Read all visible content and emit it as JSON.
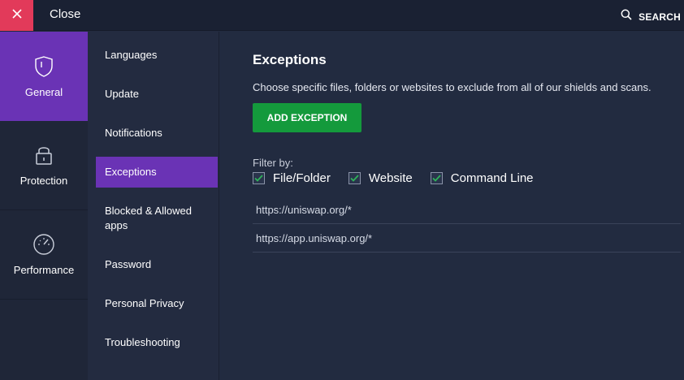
{
  "colors": {
    "accent": "#6a33b5",
    "close": "#e23a5a",
    "primary_button": "#149a3c",
    "bg_main": "#222b40"
  },
  "topbar": {
    "close_label": "Close",
    "search_label": "SEARCH"
  },
  "rail": [
    {
      "label": "General",
      "icon": "shield-icon",
      "active": true
    },
    {
      "label": "Protection",
      "icon": "lock-icon",
      "active": false
    },
    {
      "label": "Performance",
      "icon": "speedometer-icon",
      "active": false
    }
  ],
  "subnav": [
    {
      "label": "Languages"
    },
    {
      "label": "Update"
    },
    {
      "label": "Notifications"
    },
    {
      "label": "Exceptions",
      "active": true
    },
    {
      "label": "Blocked & Allowed apps"
    },
    {
      "label": "Password"
    },
    {
      "label": "Personal Privacy"
    },
    {
      "label": "Troubleshooting"
    }
  ],
  "main": {
    "title": "Exceptions",
    "description": "Choose specific files, folders or websites to exclude from all of our shields and scans.",
    "add_button": "ADD EXCEPTION",
    "filter_label": "Filter by:",
    "filters": [
      {
        "label": "File/Folder",
        "checked": true
      },
      {
        "label": "Website",
        "checked": true
      },
      {
        "label": "Command Line",
        "checked": true
      }
    ],
    "exceptions": [
      "https://uniswap.org/*",
      "https://app.uniswap.org/*"
    ]
  }
}
